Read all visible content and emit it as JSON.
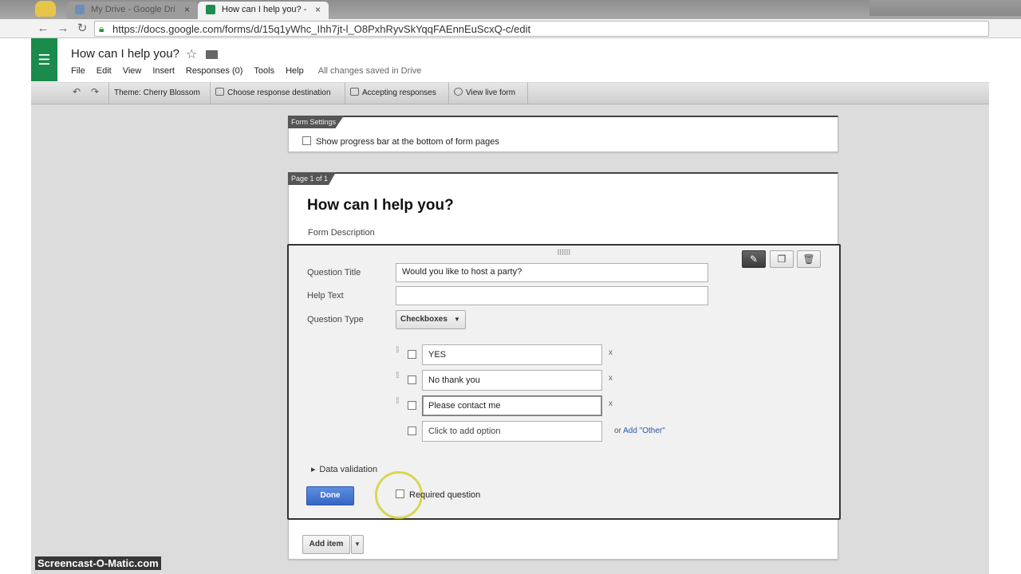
{
  "browser": {
    "tabs": [
      {
        "title": "My Drive - Google Drive",
        "active": false
      },
      {
        "title": "How can I help you? - Goo",
        "active": true
      }
    ],
    "url": "https://docs.google.com/forms/d/15q1yWhc_Ihh7jt-l_O8PxhRyvSkYqqFAEnnEuScxQ-c/edit"
  },
  "app": {
    "title": "How can I help you?",
    "menu": [
      "File",
      "Edit",
      "View",
      "Insert",
      "Responses (0)",
      "Tools",
      "Help"
    ],
    "save_status": "All changes saved in Drive",
    "brand_color": "#1a8b4b"
  },
  "form_toolbar": {
    "theme": "Theme: Cherry Blossom",
    "destination": "Choose response destination",
    "accepting": "Accepting responses",
    "view_live": "View live form"
  },
  "settings_card": {
    "tab_label": "Form Settings",
    "progress_bar_label": "Show progress bar at the bottom of form pages"
  },
  "form": {
    "tab_label": "Page 1 of 1",
    "title": "How can I help you?",
    "description_placeholder": "Form Description"
  },
  "question": {
    "title_label": "Question Title",
    "title_value": "Would you like to host a party?",
    "help_label": "Help Text",
    "help_value": "",
    "type_label": "Question Type",
    "type_value": "Checkboxes",
    "options": [
      "YES",
      "No thank you",
      "Please contact me"
    ],
    "add_option_placeholder": "Click to add option",
    "add_other_prefix": "or ",
    "add_other_link": "Add \"Other\"",
    "remove_symbol": "x",
    "data_validation": "Data validation",
    "done": "Done",
    "required": "Required question"
  },
  "add_item": {
    "label": "Add item"
  },
  "watermark": "Screencast-O-Matic.com"
}
